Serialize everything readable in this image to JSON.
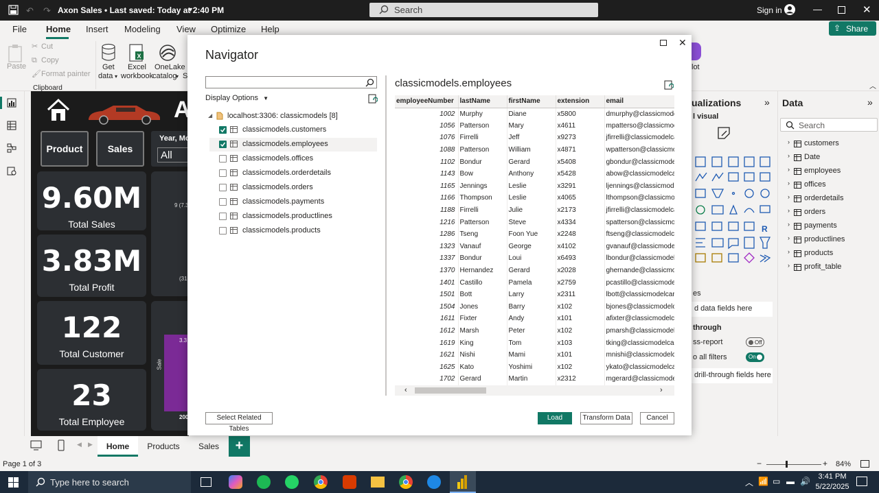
{
  "titlebar": {
    "title": "Axon Sales • Last saved: Today at 2:40 PM",
    "search_placeholder": "Search",
    "signin": "Sign in"
  },
  "menu": {
    "items": [
      "File",
      "Home",
      "Insert",
      "Modeling",
      "View",
      "Optimize",
      "Help"
    ],
    "active": "Home",
    "share": "Share"
  },
  "ribbon": {
    "paste": "Paste",
    "cut": "Cut",
    "copy": "Copy",
    "format_painter": "Format painter",
    "clipboard": "Clipboard",
    "get_data_1": "Get",
    "get_data_2": "data",
    "excel_1": "Excel",
    "excel_2": "workbook",
    "onelake_1": "OneLake",
    "onelake_2": "catalog",
    "partial_s": "S",
    "partial_lot": "lot"
  },
  "canvas": {
    "slicer_label": "Year, Mor",
    "slicer_value": "All",
    "big_letter": "A",
    "product_btn": "Product",
    "sales_btn": "Sales",
    "cards": [
      {
        "value": "9.60M",
        "label": "Total Sales"
      },
      {
        "value": "3.83M",
        "label": "Total Profit"
      },
      {
        "value": "122",
        "label": "Total Customer"
      },
      {
        "value": "23",
        "label": "Total Employee"
      }
    ],
    "frag_1": "9 (7.3",
    "frag_2": "(31",
    "frag_3": "3.3",
    "frag_4": "Sale",
    "frag_5": "200"
  },
  "viz": {
    "title": "ualizations",
    "subtitle": "l visual",
    "values_hdr": "es",
    "add_fields": "d data fields here",
    "drill": "through",
    "cross_report": "ss-report",
    "keep_filters": "o all filters",
    "off": "Off",
    "on": "On",
    "drill_fields": "drill-through fields here"
  },
  "data_pane": {
    "title": "Data",
    "search_placeholder": "Search",
    "tables": [
      "customers",
      "Date",
      "employees",
      "offices",
      "orderdetails",
      "orders",
      "payments",
      "productlines",
      "products",
      "profit_table"
    ]
  },
  "navigator": {
    "title": "Navigator",
    "display_options": "Display Options",
    "source": "localhost:3306: classicmodels [8]",
    "items": [
      {
        "name": "classicmodels.customers",
        "checked": true
      },
      {
        "name": "classicmodels.employees",
        "checked": true
      },
      {
        "name": "classicmodels.offices",
        "checked": false
      },
      {
        "name": "classicmodels.orderdetails",
        "checked": false
      },
      {
        "name": "classicmodels.orders",
        "checked": false
      },
      {
        "name": "classicmodels.payments",
        "checked": false
      },
      {
        "name": "classicmodels.productlines",
        "checked": false
      },
      {
        "name": "classicmodels.products",
        "checked": false
      }
    ],
    "preview_title": "classicmodels.employees",
    "columns": [
      "employeeNumber",
      "lastName",
      "firstName",
      "extension",
      "email"
    ],
    "rows": [
      [
        "1002",
        "Murphy",
        "Diane",
        "x5800",
        "dmurphy@classicmodelcars.com"
      ],
      [
        "1056",
        "Patterson",
        "Mary",
        "x4611",
        "mpatterso@classicmodelcars.com"
      ],
      [
        "1076",
        "Firrelli",
        "Jeff",
        "x9273",
        "jfirrelli@classicmodelcars.com"
      ],
      [
        "1088",
        "Patterson",
        "William",
        "x4871",
        "wpatterson@classicmodelcars.com"
      ],
      [
        "1102",
        "Bondur",
        "Gerard",
        "x5408",
        "gbondur@classicmodelcars.com"
      ],
      [
        "1143",
        "Bow",
        "Anthony",
        "x5428",
        "abow@classicmodelcars.com"
      ],
      [
        "1165",
        "Jennings",
        "Leslie",
        "x3291",
        "ljennings@classicmodelcars.com"
      ],
      [
        "1166",
        "Thompson",
        "Leslie",
        "x4065",
        "lthompson@classicmodelcars.com"
      ],
      [
        "1188",
        "Firrelli",
        "Julie",
        "x2173",
        "jfirrelli@classicmodelcars.com"
      ],
      [
        "1216",
        "Patterson",
        "Steve",
        "x4334",
        "spatterson@classicmodelcars.com"
      ],
      [
        "1286",
        "Tseng",
        "Foon Yue",
        "x2248",
        "ftseng@classicmodelcars.com"
      ],
      [
        "1323",
        "Vanauf",
        "George",
        "x4102",
        "gvanauf@classicmodelcars.com"
      ],
      [
        "1337",
        "Bondur",
        "Loui",
        "x6493",
        "lbondur@classicmodelcars.com"
      ],
      [
        "1370",
        "Hernandez",
        "Gerard",
        "x2028",
        "ghernande@classicmodelcars.com"
      ],
      [
        "1401",
        "Castillo",
        "Pamela",
        "x2759",
        "pcastillo@classicmodelcars.com"
      ],
      [
        "1501",
        "Bott",
        "Larry",
        "x2311",
        "lbott@classicmodelcars.com"
      ],
      [
        "1504",
        "Jones",
        "Barry",
        "x102",
        "bjones@classicmodelcars.com"
      ],
      [
        "1611",
        "Fixter",
        "Andy",
        "x101",
        "afixter@classicmodelcars.com"
      ],
      [
        "1612",
        "Marsh",
        "Peter",
        "x102",
        "pmarsh@classicmodelcars.com"
      ],
      [
        "1619",
        "King",
        "Tom",
        "x103",
        "tking@classicmodelcars.com"
      ],
      [
        "1621",
        "Nishi",
        "Mami",
        "x101",
        "mnishi@classicmodelcars.com"
      ],
      [
        "1625",
        "Kato",
        "Yoshimi",
        "x102",
        "ykato@classicmodelcars.com"
      ],
      [
        "1702",
        "Gerard",
        "Martin",
        "x2312",
        "mgerard@classicmodelcars.com"
      ]
    ],
    "select_related": "Select Related Tables",
    "load": "Load",
    "transform": "Transform Data",
    "cancel": "Cancel"
  },
  "pages": {
    "tabs": [
      "Home",
      "Products",
      "Sales"
    ],
    "active": "Home"
  },
  "status": {
    "page": "Page 1 of 3",
    "zoom": "84%"
  },
  "taskbar": {
    "search_placeholder": "Type here to search",
    "time": "3:41 PM",
    "date": "5/22/2025"
  },
  "colors": {
    "accent": "#117865",
    "canvas_bg": "#1b1b1b",
    "card_bg": "#2c2f33",
    "bar_purple": "#7b2a96"
  }
}
